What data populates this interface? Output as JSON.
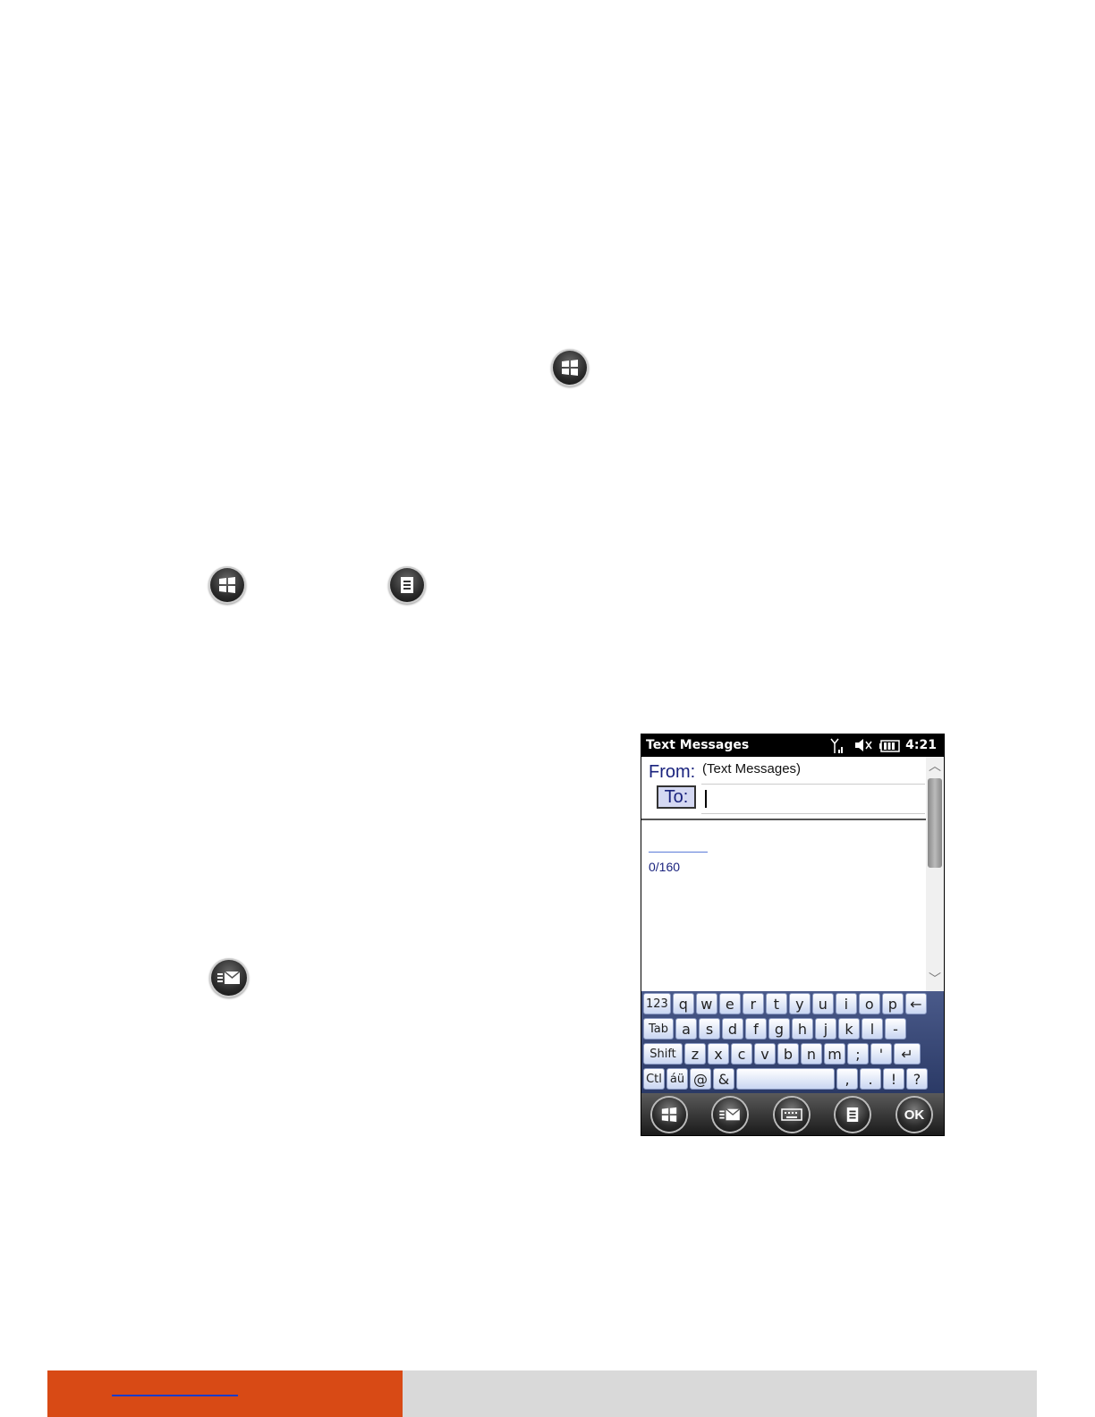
{
  "phone": {
    "title": "Text Messages",
    "time": "4:21",
    "status_icons": [
      "signal-icon",
      "speaker-muted-icon",
      "battery-icon"
    ],
    "from_label": "From:",
    "from_value": "(Text Messages)",
    "to_label": "To:",
    "to_value": "",
    "char_counter": "0/160",
    "keyboard": {
      "row1": [
        "123",
        "q",
        "w",
        "e",
        "r",
        "t",
        "y",
        "u",
        "i",
        "o",
        "p",
        "←"
      ],
      "row2": [
        "Tab",
        "a",
        "s",
        "d",
        "f",
        "g",
        "h",
        "j",
        "k",
        "l",
        "-"
      ],
      "row3": [
        "Shift",
        "z",
        "x",
        "c",
        "v",
        "b",
        "n",
        "m",
        ";",
        "'",
        "↵"
      ],
      "row4": [
        "Ctl",
        "áü",
        "@",
        "&",
        " ",
        ",",
        ".",
        "!",
        "?"
      ]
    },
    "softbar": {
      "ok_label": "OK",
      "icons": [
        "windows-start-icon",
        "send-message-icon",
        "keyboard-icon",
        "menu-icon",
        "ok-button"
      ]
    }
  },
  "inline_icons": [
    "windows-start-icon",
    "windows-start-icon",
    "menu-icon",
    "send-message-icon"
  ],
  "colors": {
    "footer_accent": "#d84a15",
    "footer_gray": "#d9d9d9",
    "link_blue": "#1a3cc9"
  }
}
